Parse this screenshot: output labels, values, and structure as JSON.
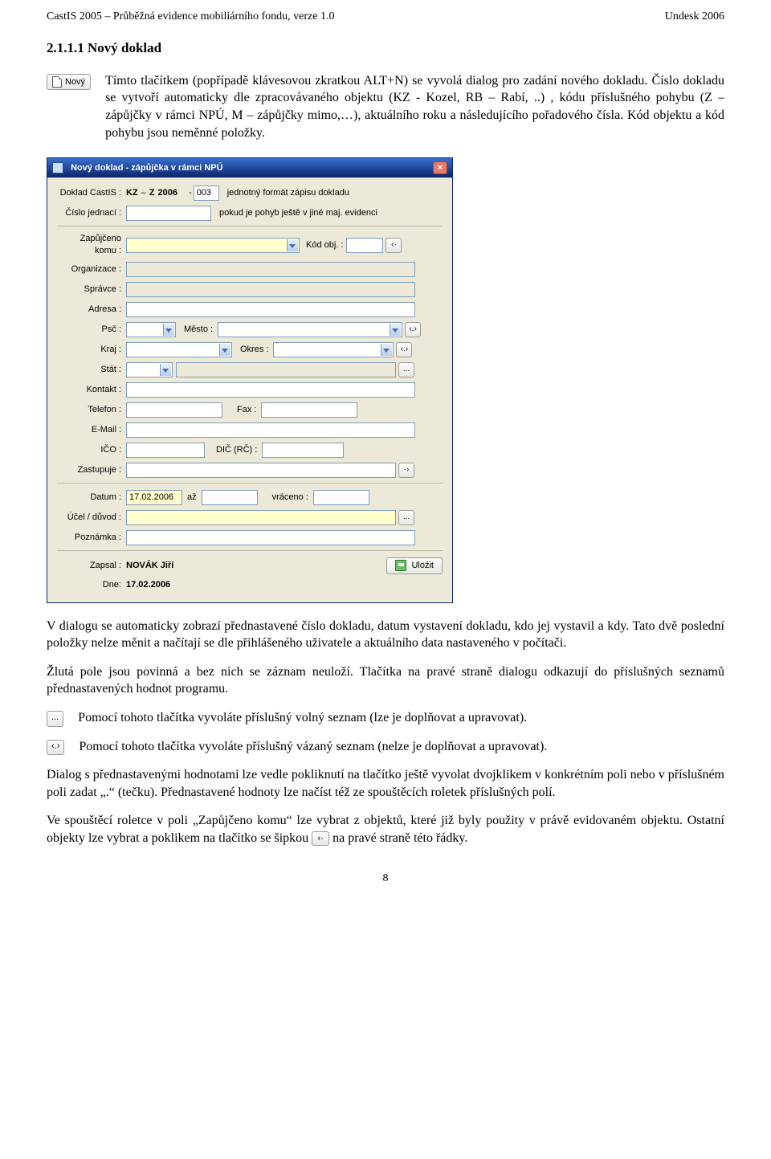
{
  "header": {
    "left": "CastIS 2005 – Průběžná evidence mobiliárního fondu, verze 1.0",
    "right": "Undesk 2006"
  },
  "section_title": "2.1.1.1 Nový doklad",
  "novy_button_label": "Nový",
  "para1": "Tímto tlačítkem (popřípadě klávesovou zkratkou ALT+N) se vyvolá dialog pro zadání nového dokladu. Číslo dokladu se vytvoří automaticky dle zpracovávaného objektu (KZ - Kozel, RB – Rabí, ..) , kódu příslušného pohybu (Z – zápůjčky v rámci NPÚ, M – zápůjčky mimo,…), aktuálního roku a následujícího pořadového čísla. Kód objektu a kód pohybu jsou neměnné položky.",
  "dialog": {
    "title": "Nový doklad - zápůjčka v rámci NPÚ",
    "doklad_label": "Doklad CastIS :",
    "doklad_k": "KZ",
    "doklad_dash": "–",
    "doklad_z": "Z",
    "doklad_year": "2006",
    "doklad_dash2": "-",
    "doklad_seq": "003",
    "doklad_note": "jednotný formát zápisu dokladu",
    "cislo_jednaci_label": "Číslo jednací :",
    "cislo_po_note": "pokud je pohyb ještě v jiné maj. evidenci",
    "zapujceno_label": "Zapůjčeno komu :",
    "kod_obj_label": "Kód obj. :",
    "organizace_label": "Organizace :",
    "spravce_label": "Správce :",
    "adresa_label": "Adresa :",
    "psc_label": "Psč :",
    "mesto_label": "Město :",
    "kraj_label": "Kraj :",
    "okres_label": "Okres :",
    "stat_label": "Stát :",
    "kontakt_label": "Kontakt :",
    "telefon_label": "Telefon :",
    "fax_label": "Fax :",
    "email_label": "E-Mail :",
    "ico_label": "IČO :",
    "dic_label": "DIČ (RČ) :",
    "zastupuje_label": "Zastupuje :",
    "datum_label": "Datum :",
    "datum_val": "17.02.2006",
    "az_label": "až",
    "vraceno_label": "vráceno :",
    "ucel_label": "Účel / důvod :",
    "poznamka_label": "Poznámka :",
    "zapsal_label": "Zapsal :",
    "zapsal_val": "NOVÁK Jiří",
    "dne_label": "Dne:",
    "dne_val": "17.02.2006",
    "save_label": "Uložit"
  },
  "para2": "V dialogu se automaticky zobrazí přednastavené číslo dokladu, datum vystavení dokladu, kdo jej vystavil a kdy. Tato dvě poslední položky nelze měnit a načítají se dle přihlášeného uživatele a aktuálního data nastaveného v počítači.",
  "para3": "Žlutá pole jsou povinná a bez nich se záznam neuloží. Tlačítka na pravé straně dialogu odkazují do příslušných seznamů přednastavených hodnot programu.",
  "btn_dots_label": "...",
  "btn_angles_label": "‹.›",
  "para4": "Pomocí tohoto tlačítka vyvoláte příslušný volný seznam (lze je doplňovat a upravovat).",
  "para5": "Pomocí tohoto tlačítka vyvoláte příslušný vázaný seznam (nelze je doplňovat a upravovat).",
  "para6": "Dialog s přednastavenými hodnotami lze vedle pokliknutí na tlačítko ještě vyvolat dvojklikem v konkrétním poli nebo v příslušném poli zadat „.“ (tečku). Přednastavené hodnoty lze načíst též ze spouštěcích roletek příslušných polí.",
  "para7a": "Ve spouštěcí roletce v poli „Zapůjčeno komu“ lze vybrat z objektů, které již byly použity v právě evidovaném objektu. Ostatní objekty lze vybrat a poklikem na tlačítko se šipkou ",
  "para7b": " na pravé straně této řádky.",
  "page_number": "8"
}
